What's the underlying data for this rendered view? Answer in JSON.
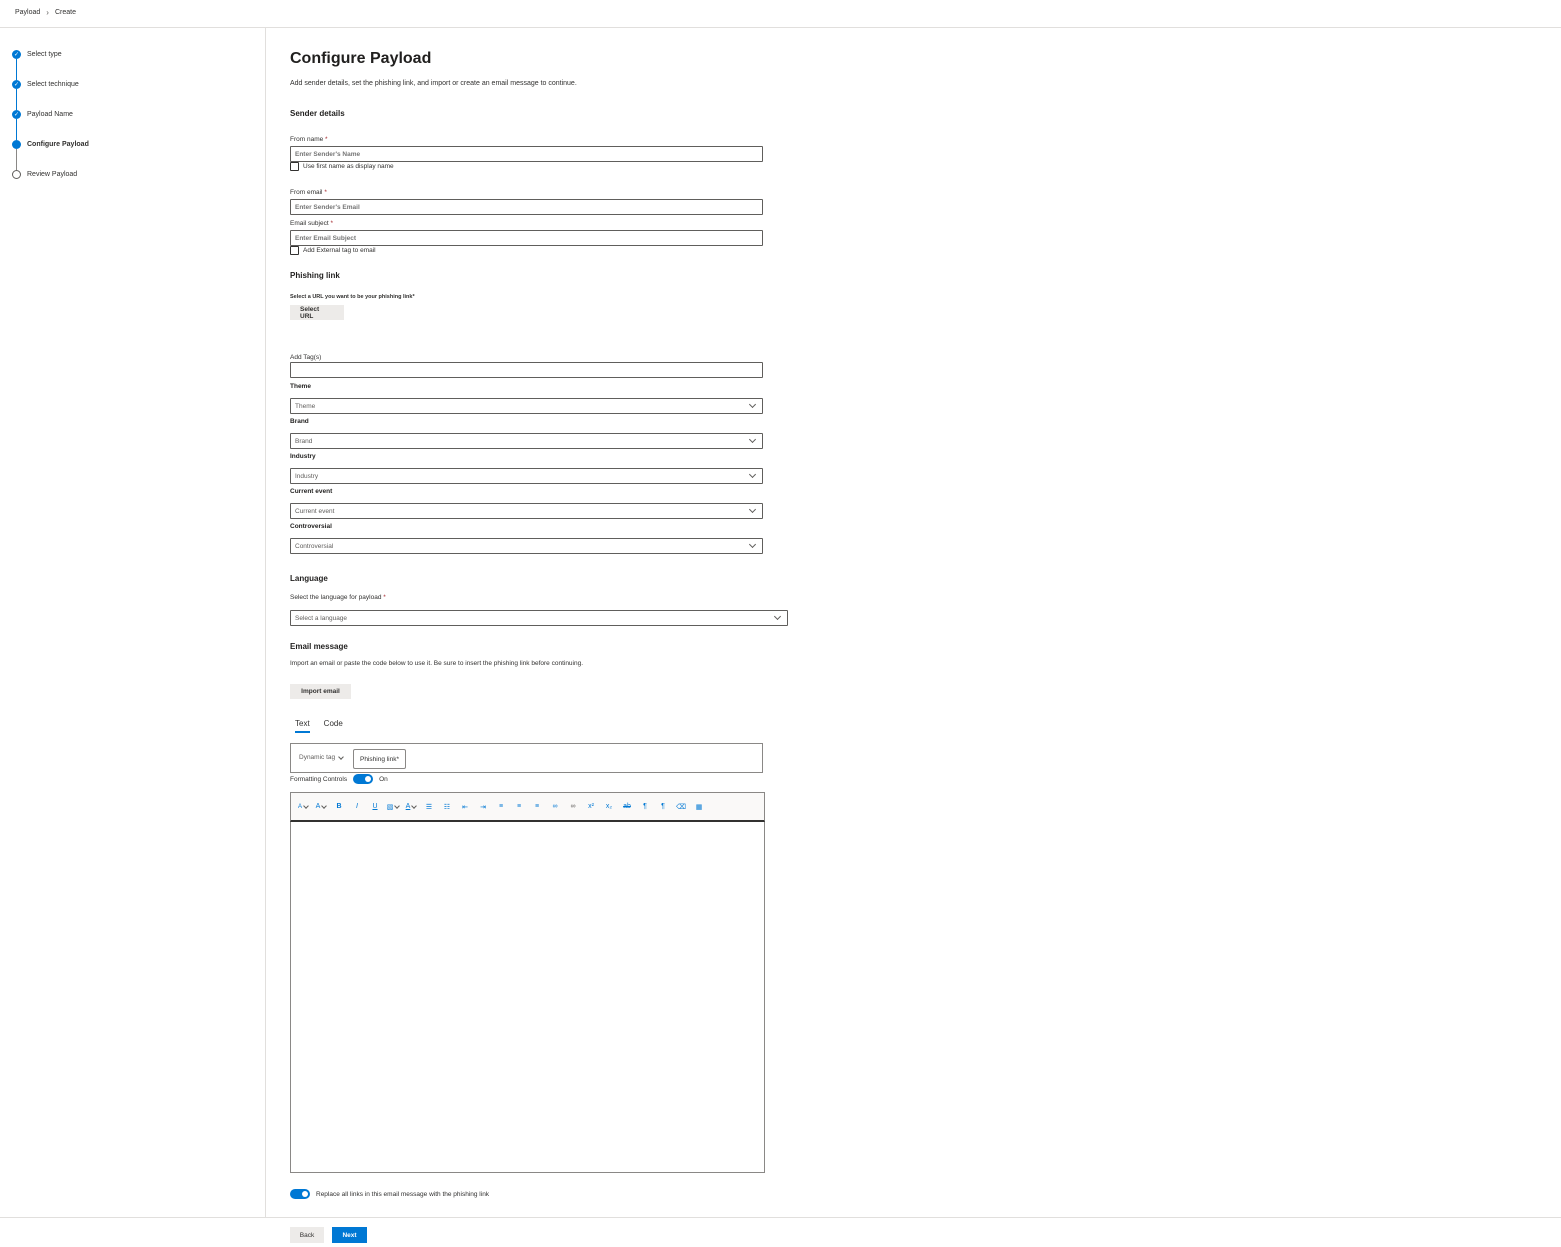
{
  "breadcrumb": {
    "root": "Payload",
    "current": "Create"
  },
  "steps": [
    {
      "label": "Select type",
      "state": "done"
    },
    {
      "label": "Select technique",
      "state": "done"
    },
    {
      "label": "Payload Name",
      "state": "done"
    },
    {
      "label": "Configure Payload",
      "state": "current"
    },
    {
      "label": "Review Payload",
      "state": "future"
    }
  ],
  "page": {
    "title": "Configure Payload",
    "description": "Add sender details, set the phishing link, and import or create an email message to continue."
  },
  "sender": {
    "heading": "Sender details",
    "from_name_label": "From name",
    "from_name_placeholder": "Enter Sender's Name",
    "use_first_name_label": "Use first name as display name",
    "from_email_label": "From email",
    "from_email_placeholder": "Enter Sender's Email",
    "subject_label": "Email subject",
    "subject_placeholder": "Enter Email Subject",
    "external_tag_label": "Add External tag to email",
    "required_mark": "*"
  },
  "phishing": {
    "heading": "Phishing link",
    "select_prompt": "Select a URL you want to be your phishing link*",
    "select_button": "Select URL"
  },
  "tags": {
    "add_tags_label": "Add Tag(s)",
    "theme_label": "Theme",
    "theme_placeholder": "Theme",
    "brand_label": "Brand",
    "brand_placeholder": "Brand",
    "industry_label": "Industry",
    "industry_placeholder": "Industry",
    "current_event_label": "Current event",
    "current_event_placeholder": "Current event",
    "controversial_label": "Controversial",
    "controversial_placeholder": "Controversial"
  },
  "language": {
    "heading": "Language",
    "select_label": "Select the language for payload",
    "placeholder": "Select a language"
  },
  "email_message": {
    "heading": "Email message",
    "description": "Import an email or paste the code below to use it. Be sure to insert the phishing link before continuing.",
    "import_button": "Import email",
    "tabs": [
      "Text",
      "Code"
    ],
    "dynamic_tag": "Dynamic tag",
    "phishing_link_button": "Phishing link*",
    "formatting_label": "Formatting Controls",
    "formatting_state": "On",
    "replace_links_label": "Replace all links in this email message with the phishing link"
  },
  "toolbar": {
    "font_icon": "A",
    "size_icon": "A",
    "bold": "B",
    "italic": "I",
    "underline": "U",
    "color": "A"
  },
  "footer": {
    "back": "Back",
    "next": "Next"
  },
  "colors": {
    "accent": "#0078d4",
    "required": "#a4262c"
  }
}
